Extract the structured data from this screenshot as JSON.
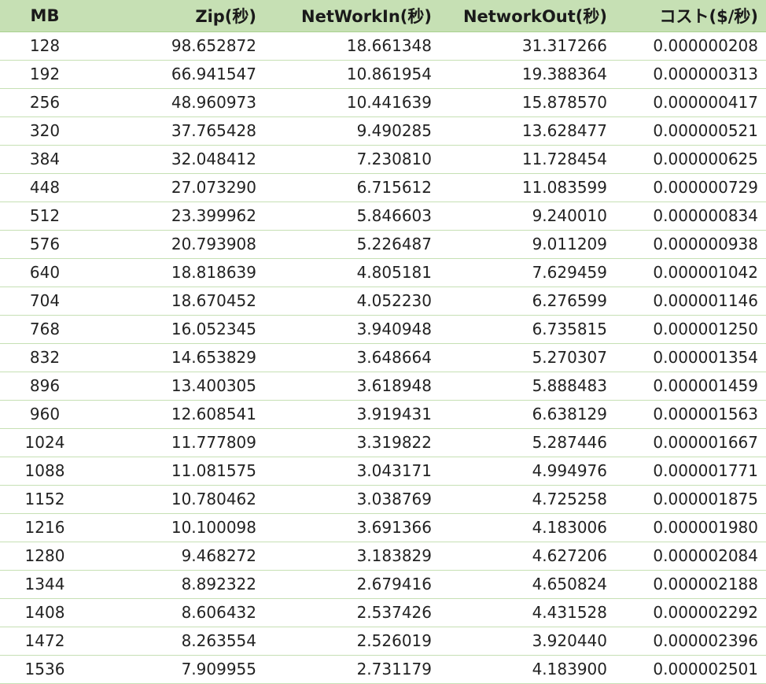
{
  "table": {
    "headers": [
      "MB",
      "Zip(秒)",
      "NetWorkIn(秒)",
      "NetworkOut(秒)",
      "コスト($/秒)"
    ],
    "rows": [
      [
        "128",
        "98.652872",
        "18.661348",
        "31.317266",
        "0.000000208"
      ],
      [
        "192",
        "66.941547",
        "10.861954",
        "19.388364",
        "0.000000313"
      ],
      [
        "256",
        "48.960973",
        "10.441639",
        "15.878570",
        "0.000000417"
      ],
      [
        "320",
        "37.765428",
        "9.490285",
        "13.628477",
        "0.000000521"
      ],
      [
        "384",
        "32.048412",
        "7.230810",
        "11.728454",
        "0.000000625"
      ],
      [
        "448",
        "27.073290",
        "6.715612",
        "11.083599",
        "0.000000729"
      ],
      [
        "512",
        "23.399962",
        "5.846603",
        "9.240010",
        "0.000000834"
      ],
      [
        "576",
        "20.793908",
        "5.226487",
        "9.011209",
        "0.000000938"
      ],
      [
        "640",
        "18.818639",
        "4.805181",
        "7.629459",
        "0.000001042"
      ],
      [
        "704",
        "18.670452",
        "4.052230",
        "6.276599",
        "0.000001146"
      ],
      [
        "768",
        "16.052345",
        "3.940948",
        "6.735815",
        "0.000001250"
      ],
      [
        "832",
        "14.653829",
        "3.648664",
        "5.270307",
        "0.000001354"
      ],
      [
        "896",
        "13.400305",
        "3.618948",
        "5.888483",
        "0.000001459"
      ],
      [
        "960",
        "12.608541",
        "3.919431",
        "6.638129",
        "0.000001563"
      ],
      [
        "1024",
        "11.777809",
        "3.319822",
        "5.287446",
        "0.000001667"
      ],
      [
        "1088",
        "11.081575",
        "3.043171",
        "4.994976",
        "0.000001771"
      ],
      [
        "1152",
        "10.780462",
        "3.038769",
        "4.725258",
        "0.000001875"
      ],
      [
        "1216",
        "10.100098",
        "3.691366",
        "4.183006",
        "0.000001980"
      ],
      [
        "1280",
        "9.468272",
        "3.183829",
        "4.627206",
        "0.000002084"
      ],
      [
        "1344",
        "8.892322",
        "2.679416",
        "4.650824",
        "0.000002188"
      ],
      [
        "1408",
        "8.606432",
        "2.537426",
        "4.431528",
        "0.000002292"
      ],
      [
        "1472",
        "8.263554",
        "2.526019",
        "3.920440",
        "0.000002396"
      ],
      [
        "1536",
        "7.909955",
        "2.731179",
        "4.183900",
        "0.000002501"
      ]
    ]
  },
  "colors": {
    "header_fill": "#c6e0b4",
    "row_border": "#c6e0b4",
    "text": "#222222"
  }
}
